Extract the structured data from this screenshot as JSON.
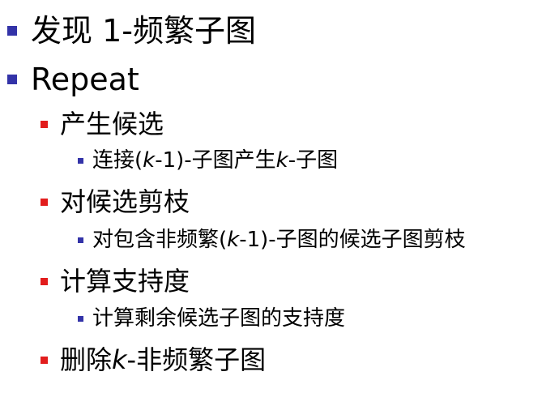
{
  "slide": {
    "items": [
      {
        "level": 1,
        "text": "发现 1-频繁子图"
      },
      {
        "level": 1,
        "text": "Repeat"
      },
      {
        "level": 2,
        "text": "产生候选"
      },
      {
        "level": 3,
        "pre": "连接(",
        "var": "k",
        "post": "-1)-子图产生",
        "var2": "k",
        "post2": "-子图"
      },
      {
        "level": 2,
        "text": "对候选剪枝"
      },
      {
        "level": 3,
        "pre": "对包含非频繁(",
        "var": "k",
        "post": "-1)-子图的候选子图剪枝"
      },
      {
        "level": 2,
        "text": "计算支持度"
      },
      {
        "level": 3,
        "text": "计算剩余候选子图的支持度"
      },
      {
        "level": 2,
        "pre": "删除",
        "var": "k",
        "post": "-非频繁子图"
      }
    ]
  },
  "colors": {
    "level1_bullet": "#3333a8",
    "level2_bullet": "#e21d1d",
    "level3_bullet": "#3333a8",
    "text": "#000000",
    "background": "#ffffff"
  }
}
